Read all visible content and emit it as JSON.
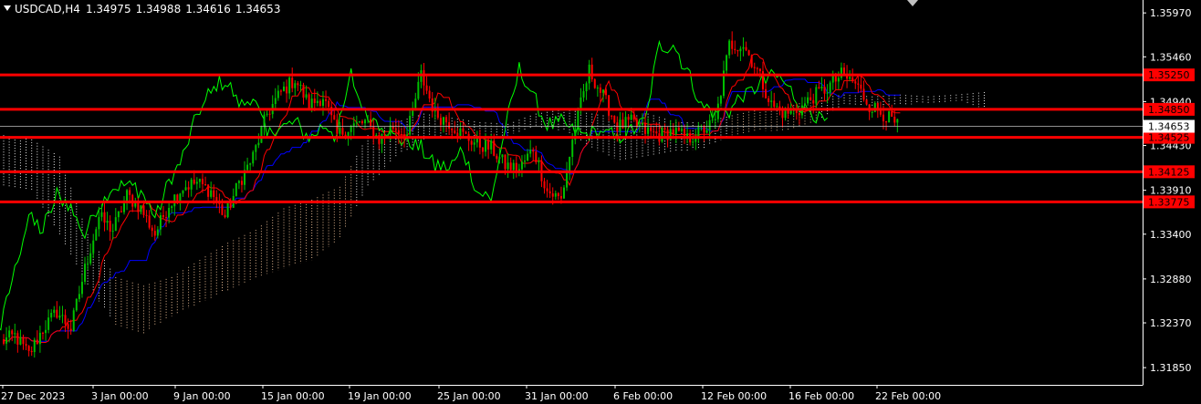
{
  "chart_data": {
    "type": "candlestick",
    "title": {
      "symbol": "USDCAD,H4",
      "open": "1.34975",
      "high": "1.34988",
      "low": "1.34616",
      "close": "1.34653"
    },
    "y_axis": {
      "range": [
        1.3165,
        1.3612
      ],
      "ticks": [
        "1.35970",
        "1.35460",
        "1.34940",
        "1.34430",
        "1.33910",
        "1.33400",
        "1.32880",
        "1.32370",
        "1.31850"
      ]
    },
    "x_axis": {
      "ticks": [
        "27 Dec 2023",
        "3 Jan 00:00",
        "9 Jan 00:00",
        "15 Jan 00:00",
        "19 Jan 00:00",
        "25 Jan 00:00",
        "31 Jan 00:00",
        "6 Feb 00:00",
        "12 Feb 00:00",
        "16 Feb 00:00",
        "22 Feb 00:00"
      ]
    },
    "current_price": "1.34653",
    "horizontal_levels": [
      "1.35250",
      "1.34850",
      "1.34525",
      "1.34125",
      "1.33775"
    ],
    "colors": {
      "background": "#000000",
      "bull_candle": "#00c000",
      "bear_candle": "#ff0000",
      "level_line": "#ff0000",
      "tenkan": "#ff0000",
      "kijun": "#0000ff",
      "chikou": "#00ff00",
      "kumo_up": "#f4c59b",
      "kumo_down": "#ffffff",
      "axis_text": "#ffffff",
      "current_price_box": "#ffffff"
    },
    "anchor_closes": [
      [
        0,
        1.3215
      ],
      [
        5,
        1.3222
      ],
      [
        10,
        1.32
      ],
      [
        15,
        1.323
      ],
      [
        20,
        1.325
      ],
      [
        25,
        1.323
      ],
      [
        30,
        1.33
      ],
      [
        35,
        1.336
      ],
      [
        40,
        1.3345
      ],
      [
        45,
        1.3385
      ],
      [
        50,
        1.337
      ],
      [
        55,
        1.334
      ],
      [
        60,
        1.3375
      ],
      [
        65,
        1.3395
      ],
      [
        70,
        1.34
      ],
      [
        75,
        1.339
      ],
      [
        80,
        1.336
      ],
      [
        85,
        1.34
      ],
      [
        90,
        1.343
      ],
      [
        95,
        1.348
      ],
      [
        100,
        1.3505
      ],
      [
        105,
        1.352
      ],
      [
        110,
        1.349
      ],
      [
        115,
        1.35
      ],
      [
        120,
        1.3455
      ],
      [
        125,
        1.3465
      ],
      [
        130,
        1.347
      ],
      [
        135,
        1.345
      ],
      [
        140,
        1.3465
      ],
      [
        145,
        1.3455
      ],
      [
        150,
        1.3525
      ],
      [
        155,
        1.348
      ],
      [
        160,
        1.347
      ],
      [
        165,
        1.3455
      ],
      [
        170,
        1.3445
      ],
      [
        175,
        1.344
      ],
      [
        180,
        1.342
      ],
      [
        185,
        1.3415
      ],
      [
        190,
        1.344
      ],
      [
        195,
        1.339
      ],
      [
        200,
        1.338
      ],
      [
        205,
        1.3465
      ],
      [
        210,
        1.353
      ],
      [
        215,
        1.35
      ],
      [
        220,
        1.3465
      ],
      [
        225,
        1.347
      ],
      [
        230,
        1.346
      ],
      [
        235,
        1.3455
      ],
      [
        240,
        1.346
      ],
      [
        245,
        1.345
      ],
      [
        250,
        1.346
      ],
      [
        255,
        1.347
      ],
      [
        260,
        1.356
      ],
      [
        265,
        1.356
      ],
      [
        270,
        1.353
      ],
      [
        275,
        1.349
      ],
      [
        280,
        1.348
      ],
      [
        285,
        1.3485
      ],
      [
        290,
        1.35
      ],
      [
        295,
        1.351
      ],
      [
        300,
        1.3525
      ],
      [
        305,
        1.3515
      ],
      [
        310,
        1.349
      ],
      [
        315,
        1.348
      ],
      [
        320,
        1.3465
      ]
    ],
    "kumo": [
      [
        0,
        1.3455,
        1.3395
      ],
      [
        10,
        1.345,
        1.339
      ],
      [
        20,
        1.343,
        1.334
      ],
      [
        30,
        1.334,
        1.328
      ],
      [
        40,
        1.329,
        1.3235
      ],
      [
        50,
        1.328,
        1.3225
      ],
      [
        60,
        1.329,
        1.3245
      ],
      [
        70,
        1.331,
        1.326
      ],
      [
        80,
        1.333,
        1.3275
      ],
      [
        90,
        1.3345,
        1.329
      ],
      [
        100,
        1.337,
        1.33
      ],
      [
        110,
        1.338,
        1.331
      ],
      [
        120,
        1.3395,
        1.3335
      ],
      [
        130,
        1.3455,
        1.3395
      ],
      [
        140,
        1.347,
        1.343
      ],
      [
        150,
        1.348,
        1.345
      ],
      [
        160,
        1.3475,
        1.3455
      ],
      [
        170,
        1.347,
        1.345
      ],
      [
        180,
        1.3468,
        1.3455
      ],
      [
        190,
        1.348,
        1.3465
      ],
      [
        200,
        1.3485,
        1.346
      ],
      [
        210,
        1.348,
        1.344
      ],
      [
        220,
        1.3475,
        1.3425
      ],
      [
        230,
        1.348,
        1.343
      ],
      [
        240,
        1.347,
        1.3435
      ],
      [
        250,
        1.347,
        1.344
      ],
      [
        260,
        1.3478,
        1.3455
      ],
      [
        270,
        1.3485,
        1.346
      ],
      [
        280,
        1.3488,
        1.346
      ],
      [
        290,
        1.3498,
        1.347
      ],
      [
        300,
        1.3502,
        1.349
      ],
      [
        310,
        1.35,
        1.3488
      ],
      [
        320,
        1.3502,
        1.349
      ],
      [
        330,
        1.35,
        1.3492
      ],
      [
        340,
        1.3502,
        1.3495
      ],
      [
        350,
        1.3505,
        1.3486
      ]
    ]
  }
}
